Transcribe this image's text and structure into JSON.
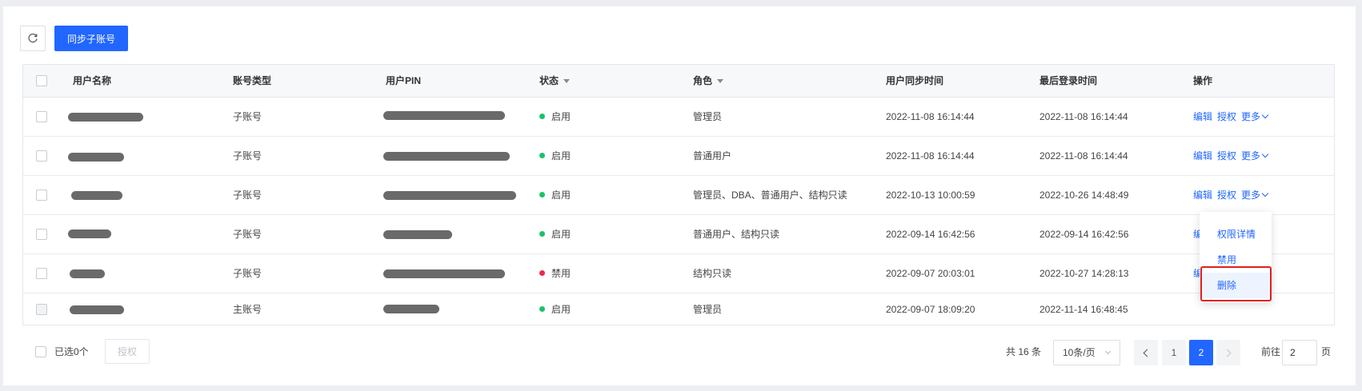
{
  "toolbar": {
    "refresh_icon": "refresh-icon",
    "sync_label": "同步子账号"
  },
  "table": {
    "headers": {
      "name": "用户名称",
      "type": "账号类型",
      "pin": "用户PIN",
      "status": "状态",
      "role": "角色",
      "sync_time": "用户同步时间",
      "last_login": "最后登录时间",
      "actions": "操作"
    },
    "rows": [
      {
        "type": "子账号",
        "status": "启用",
        "status_color": "#19c26a",
        "role": "管理员",
        "sync_time": "2022-11-08 16:14:44",
        "last_login": "2022-11-08 16:14:44",
        "actions": [
          "编辑",
          "授权",
          "更多"
        ]
      },
      {
        "type": "子账号",
        "status": "启用",
        "status_color": "#19c26a",
        "role": "普通用户",
        "sync_time": "2022-11-08 16:14:44",
        "last_login": "2022-11-08 16:14:44",
        "actions": [
          "编辑",
          "授权",
          "更多"
        ]
      },
      {
        "type": "子账号",
        "status": "启用",
        "status_color": "#19c26a",
        "role": "管理员、DBA、普通用户、结构只读",
        "sync_time": "2022-10-13 10:00:59",
        "last_login": "2022-10-26 14:48:49",
        "actions": [
          "编辑",
          "授权",
          "更多"
        ]
      },
      {
        "type": "子账号",
        "status": "启用",
        "status_color": "#19c26a",
        "role": "普通用户、结构只读",
        "sync_time": "2022-09-14 16:42:56",
        "last_login": "2022-09-14 16:42:56",
        "actions": [
          "编"
        ]
      },
      {
        "type": "子账号",
        "status": "禁用",
        "status_color": "#f0284a",
        "role": "结构只读",
        "sync_time": "2022-09-07 20:03:01",
        "last_login": "2022-10-27 14:28:13",
        "actions": [
          "编"
        ]
      },
      {
        "type": "主账号",
        "status": "启用",
        "status_color": "#19c26a",
        "role": "管理员",
        "sync_time": "2022-09-07 18:09:20",
        "last_login": "2022-11-14 16:48:45",
        "actions": []
      }
    ]
  },
  "dropdown": {
    "items": [
      "权限详情",
      "禁用",
      "删除"
    ],
    "highlighted": "删除"
  },
  "footer": {
    "selected": "已选0个",
    "grant": "授权",
    "total": "共 16 条",
    "page_size": "10条/页",
    "pages": [
      "1",
      "2"
    ],
    "current_page": "2",
    "goto_label": "前往",
    "goto_value": "2",
    "goto_suffix": "页"
  },
  "colors": {
    "accent": "#2166ff",
    "enabled": "#19c26a",
    "disabled": "#f0284a",
    "highlight_border": "#e02020"
  }
}
